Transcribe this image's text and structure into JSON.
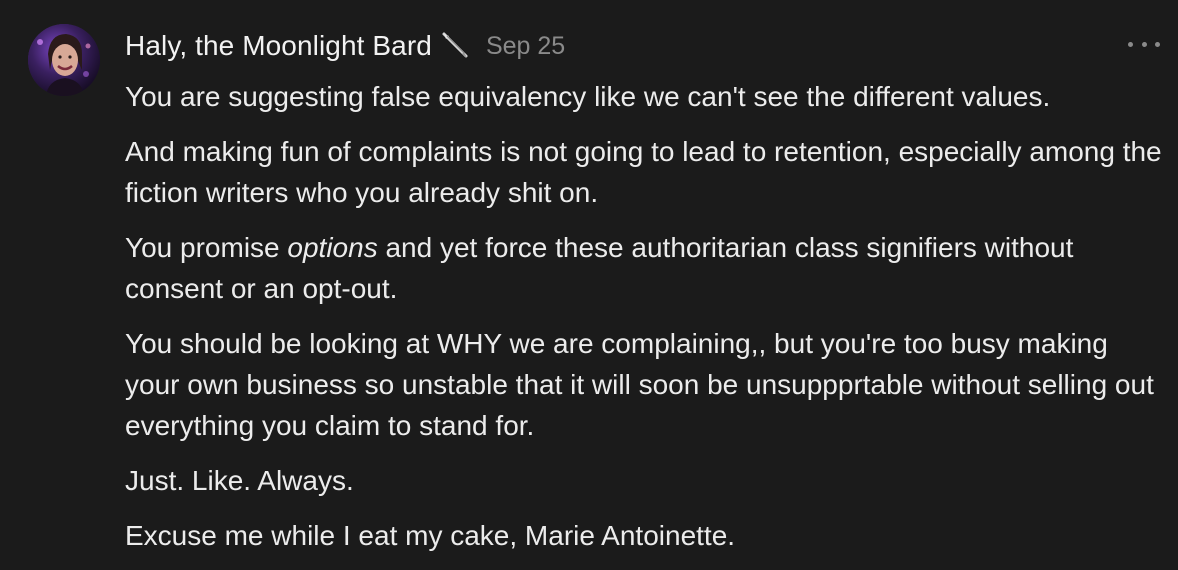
{
  "comment": {
    "author": "Haly, the Moonlight Bard",
    "author_badge_icon": "quill-pen-icon",
    "date": "Sep 25",
    "more_icon": "more-options-icon",
    "paragraphs": [
      {
        "text": "You are suggesting false equivalency like we can't see the different values."
      },
      {
        "text": "And making fun of complaints is not going to lead to retention, especially among the fiction writers who you already shit on."
      },
      {
        "before": "You promise ",
        "emphasis": "options",
        "after": " and yet force these authoritarian class signifiers without consent or an opt-out."
      },
      {
        "text": "You should be looking at WHY we are complaining,, but you're too busy making your own business so unstable that it will soon be unsuppprtable without selling out everything you claim to stand for."
      },
      {
        "text": "Just. Like. Always."
      },
      {
        "text": "Excuse me while I eat my cake, Marie Antoinette."
      }
    ]
  },
  "colors": {
    "background": "#1b1b1b",
    "text": "#ececec",
    "muted": "#8a8a8a"
  }
}
